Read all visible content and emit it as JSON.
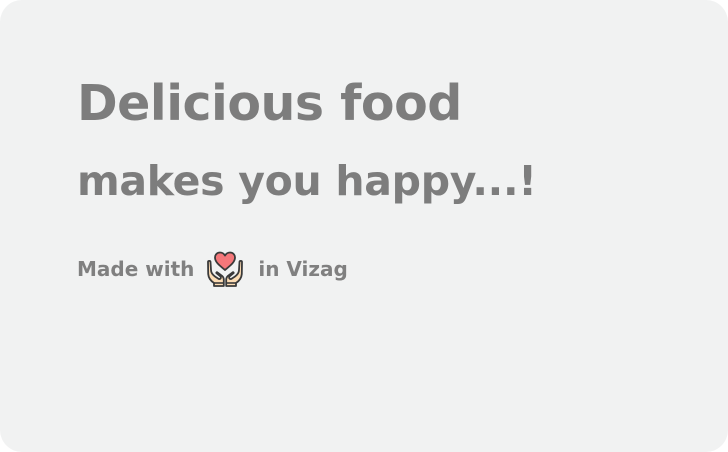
{
  "card": {
    "headline": "Delicious food",
    "subline": "makes you happy...!",
    "made_with_prefix": "Made with",
    "made_with_icon": "hands-holding-heart-icon",
    "made_with_suffix": "in Vizag"
  },
  "colors": {
    "card_background": "#f1f2f2",
    "text": "#7d7d7d",
    "heart": "#f4777a",
    "hands": "#fcdcb4",
    "outline": "#3a3a3a"
  }
}
